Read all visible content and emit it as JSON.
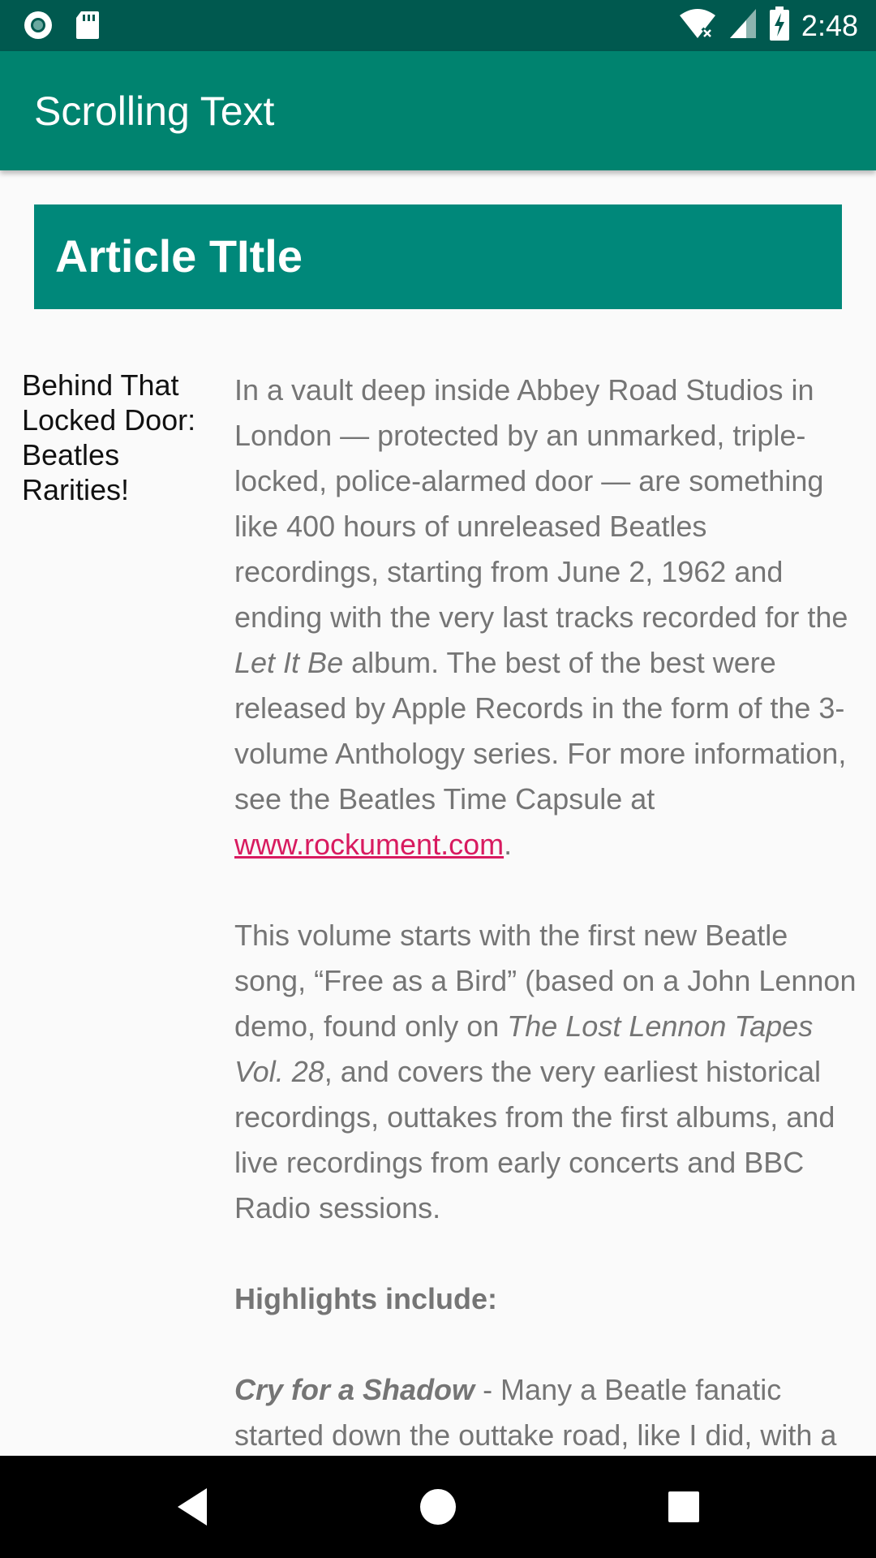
{
  "status_bar": {
    "time": "2:48",
    "icons": [
      "record-icon",
      "sd-card-icon",
      "wifi-off-icon",
      "signal-icon",
      "battery-charging-icon"
    ]
  },
  "app_bar": {
    "title": "Scrolling Text"
  },
  "article": {
    "title": "Article TItle",
    "subheading": "Behind That Locked Door: Beatles Rarities!",
    "p1": {
      "text_a": "In a vault deep inside Abbey Road Studios in London — protected by an unmarked, triple-locked, police-alarmed door — are something like 400 hours of unreleased Beatles recordings, starting from June 2, 1962 and ending with the very last tracks recorded for the ",
      "italic": "Let It Be",
      "text_b": " album. The best of the best were released by Apple Records in the form of the 3-volume Anthology series. For more information, see the Beatles Time Capsule at ",
      "link": "www.rockument.com",
      "text_c": "."
    },
    "p2": {
      "text_a": " This volume starts with the first new Beatle song, “Free as a Bird” (based on a John Lennon demo, found only on ",
      "italic": "The Lost Lennon Tapes Vol. 28",
      "text_b": ", and covers the very earliest historical recordings, outtakes from the first albums, and live recordings from early concerts and BBC Radio sessions."
    },
    "p3": {
      "bold": " Highlights include:"
    },
    "p4": {
      "bold_italic": " Cry for a Shadow",
      "text": " - Many a Beatle fanatic started down the outtake road, like I did, with a"
    }
  },
  "nav_bar": {
    "buttons": [
      "back-icon",
      "home-icon",
      "recents-icon"
    ]
  },
  "colors": {
    "status_bar": "#00594f",
    "app_bar": "#00836f",
    "title_bar": "#00887a",
    "link": "#d81b60",
    "body_text": "#757575"
  }
}
